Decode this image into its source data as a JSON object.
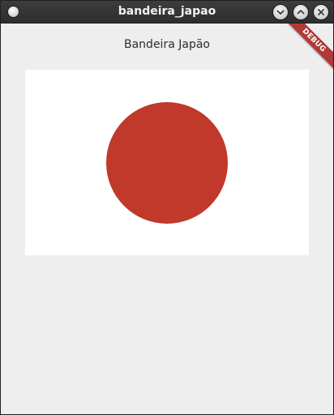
{
  "window": {
    "title": "bandeira_japao",
    "buttons": {
      "minimize_icon": "chevron-down-icon",
      "maximize_icon": "chevron-up-icon",
      "close_icon": "close-icon"
    }
  },
  "app": {
    "heading": "Bandeira Japão",
    "debug_banner": "DEBUG"
  },
  "colors": {
    "flag_background": "#ffffff",
    "sun": "#c0392b",
    "debug_ribbon": "#b03a3a",
    "client_background": "#eeeeee"
  }
}
